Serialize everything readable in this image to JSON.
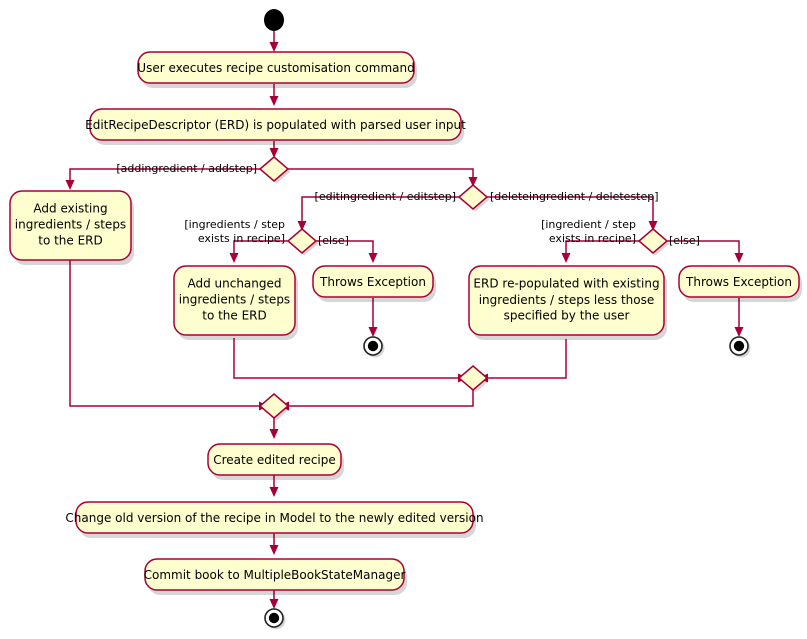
{
  "diagram": {
    "title": "Recipe customisation command activity diagram",
    "type": "uml-activity-diagram",
    "colors": {
      "node_fill": "#FEFECE",
      "node_border": "#A80036",
      "edge": "#A80036",
      "text": "#000000",
      "background": "#FFFFFF",
      "terminal": "#000000"
    },
    "nodes": {
      "start": {
        "kind": "initial-node"
      },
      "user_command": {
        "kind": "action",
        "text": "User executes recipe customisation command"
      },
      "erd_populated": {
        "kind": "action",
        "text": "EditRecipeDescriptor (ERD) is populated with parsed user input"
      },
      "decision_command_type": {
        "kind": "decision"
      },
      "decision_edit_delete": {
        "kind": "decision"
      },
      "decision_edit_exists": {
        "kind": "decision"
      },
      "decision_delete_exists": {
        "kind": "decision"
      },
      "add_existing": {
        "kind": "action",
        "lines": [
          "Add existing",
          "ingredients / steps",
          "to the ERD"
        ]
      },
      "add_unchanged": {
        "kind": "action",
        "lines": [
          "Add unchanged",
          "ingredients / steps",
          "to the ERD"
        ]
      },
      "throws_exception_edit": {
        "kind": "action",
        "text": "Throws Exception"
      },
      "erd_repopulated": {
        "kind": "action",
        "lines": [
          [
            {
              "t": "ERD re-populated with existing",
              "bold": false
            }
          ],
          [
            {
              "t": "ingredients / steps ",
              "bold": false
            },
            {
              "t": "less",
              "bold": true
            },
            {
              "t": " those",
              "bold": false
            }
          ],
          [
            {
              "t": "specified by the user",
              "bold": false
            }
          ]
        ]
      },
      "throws_exception_delete": {
        "kind": "action",
        "text": "Throws Exception"
      },
      "merge_right": {
        "kind": "merge"
      },
      "merge_main": {
        "kind": "merge"
      },
      "create_recipe": {
        "kind": "action",
        "text": "Create edited recipe"
      },
      "change_version": {
        "kind": "action",
        "text": "Change old version of the recipe in Model to the newly edited version"
      },
      "commit_book": {
        "kind": "action",
        "text": "Commit book to MultipleBookStateManager"
      },
      "end_edit_exception": {
        "kind": "final-node"
      },
      "end_delete_exception": {
        "kind": "final-node"
      },
      "end_main": {
        "kind": "final-node"
      }
    },
    "guards": {
      "add": "[addingredient / addstep]",
      "edit": "[editingredient / editstep]",
      "delete": "[deleteingredient / deletestep]",
      "edit_exists_line1": "[ingredients / step",
      "edit_exists_line2": "exists in recipe]",
      "edit_else": "[else]",
      "delete_exists_line1": "[ingredient / step",
      "delete_exists_line2": "exists in recipe]",
      "delete_else": "[else]"
    }
  }
}
